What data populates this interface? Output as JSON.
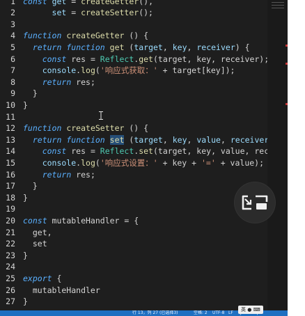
{
  "editor": {
    "lines": [
      {
        "n": "1",
        "tokens": [
          {
            "t": "const",
            "c": "kw"
          },
          {
            "t": " "
          },
          {
            "t": "get",
            "c": "var"
          },
          {
            "t": " = "
          },
          {
            "t": "createGetter",
            "c": "fn"
          },
          {
            "t": "(),"
          }
        ]
      },
      {
        "n": "2",
        "tokens": [
          {
            "t": "      "
          },
          {
            "t": "set",
            "c": "var"
          },
          {
            "t": " = "
          },
          {
            "t": "createSetter",
            "c": "fn"
          },
          {
            "t": "();"
          }
        ]
      },
      {
        "n": "3",
        "tokens": []
      },
      {
        "n": "4",
        "tokens": [
          {
            "t": "function",
            "c": "kw"
          },
          {
            "t": " "
          },
          {
            "t": "createGetter",
            "c": "fn"
          },
          {
            "t": " () {"
          }
        ]
      },
      {
        "n": "5",
        "tokens": [
          {
            "t": "  "
          },
          {
            "t": "return",
            "c": "kw"
          },
          {
            "t": " "
          },
          {
            "t": "function",
            "c": "kw"
          },
          {
            "t": " "
          },
          {
            "t": "get",
            "c": "fn"
          },
          {
            "t": " ("
          },
          {
            "t": "target",
            "c": "var"
          },
          {
            "t": ", "
          },
          {
            "t": "key",
            "c": "var"
          },
          {
            "t": ", "
          },
          {
            "t": "receiver",
            "c": "var"
          },
          {
            "t": ") {"
          }
        ]
      },
      {
        "n": "6",
        "tokens": [
          {
            "t": "    "
          },
          {
            "t": "const",
            "c": "kw"
          },
          {
            "t": " res = "
          },
          {
            "t": "Reflect",
            "c": "cls"
          },
          {
            "t": "."
          },
          {
            "t": "get",
            "c": "fn"
          },
          {
            "t": "(target, key, receiver);"
          }
        ]
      },
      {
        "n": "7",
        "tokens": [
          {
            "t": "    "
          },
          {
            "t": "console",
            "c": "var"
          },
          {
            "t": "."
          },
          {
            "t": "log",
            "c": "fn"
          },
          {
            "t": "("
          },
          {
            "t": "'响应式获取：'",
            "c": "str"
          },
          {
            "t": " + target[key]);"
          }
        ]
      },
      {
        "n": "8",
        "tokens": [
          {
            "t": "    "
          },
          {
            "t": "return",
            "c": "kw"
          },
          {
            "t": " res;"
          }
        ]
      },
      {
        "n": "9",
        "tokens": [
          {
            "t": "  }"
          }
        ]
      },
      {
        "n": "10",
        "tokens": [
          {
            "t": "}"
          }
        ]
      },
      {
        "n": "11",
        "tokens": []
      },
      {
        "n": "12",
        "tokens": [
          {
            "t": "function",
            "c": "kw"
          },
          {
            "t": " "
          },
          {
            "t": "createSetter",
            "c": "fn"
          },
          {
            "t": " () {"
          }
        ]
      },
      {
        "n": "13",
        "tokens": [
          {
            "t": "  "
          },
          {
            "t": "return",
            "c": "kw"
          },
          {
            "t": " "
          },
          {
            "t": "function",
            "c": "kw"
          },
          {
            "t": " "
          },
          {
            "t": "set",
            "c": "fn",
            "hl": true
          },
          {
            "t": " ("
          },
          {
            "t": "target",
            "c": "var"
          },
          {
            "t": ", "
          },
          {
            "t": "key",
            "c": "var"
          },
          {
            "t": ", "
          },
          {
            "t": "value",
            "c": "var"
          },
          {
            "t": ", "
          },
          {
            "t": "receiver",
            "c": "var"
          },
          {
            "t": ")"
          }
        ]
      },
      {
        "n": "14",
        "tokens": [
          {
            "t": "    "
          },
          {
            "t": "const",
            "c": "kw"
          },
          {
            "t": " res = "
          },
          {
            "t": "Reflect",
            "c": "cls"
          },
          {
            "t": "."
          },
          {
            "t": "set",
            "c": "fn"
          },
          {
            "t": "(target, key, value, recei"
          }
        ]
      },
      {
        "n": "15",
        "tokens": [
          {
            "t": "    "
          },
          {
            "t": "console",
            "c": "var"
          },
          {
            "t": "."
          },
          {
            "t": "log",
            "c": "fn"
          },
          {
            "t": "("
          },
          {
            "t": "'响应式设置：'",
            "c": "str"
          },
          {
            "t": " + key + "
          },
          {
            "t": "'='",
            "c": "str"
          },
          {
            "t": " + value);"
          }
        ]
      },
      {
        "n": "16",
        "tokens": [
          {
            "t": "    "
          },
          {
            "t": "return",
            "c": "kw"
          },
          {
            "t": " res;"
          }
        ]
      },
      {
        "n": "17",
        "tokens": [
          {
            "t": "  }"
          }
        ]
      },
      {
        "n": "18",
        "tokens": [
          {
            "t": "}"
          }
        ]
      },
      {
        "n": "19",
        "tokens": []
      },
      {
        "n": "20",
        "tokens": [
          {
            "t": "const",
            "c": "kw"
          },
          {
            "t": " mutableHandler = {"
          }
        ]
      },
      {
        "n": "21",
        "tokens": [
          {
            "t": "  get,"
          }
        ]
      },
      {
        "n": "22",
        "tokens": [
          {
            "t": "  set"
          }
        ]
      },
      {
        "n": "23",
        "tokens": [
          {
            "t": "}"
          }
        ]
      },
      {
        "n": "24",
        "tokens": []
      },
      {
        "n": "25",
        "tokens": [
          {
            "t": "export",
            "c": "kw"
          },
          {
            "t": " {"
          }
        ]
      },
      {
        "n": "26",
        "tokens": [
          {
            "t": "  mutableHandler"
          }
        ]
      },
      {
        "n": "27",
        "tokens": [
          {
            "t": "}"
          }
        ]
      }
    ]
  },
  "statusbar": {
    "position": "行 13，列 27 (已选择3)",
    "spaces": "空格: 2",
    "encoding": "UTF-8",
    "eol": "LF",
    "language": "JavaScript",
    "color": "#1e6fc1"
  },
  "ime": {
    "label": "英",
    "icons": [
      "ime-mode-icon",
      "keyboard-icon"
    ]
  },
  "overlay": {
    "icon": "picture-in-picture-icon"
  }
}
